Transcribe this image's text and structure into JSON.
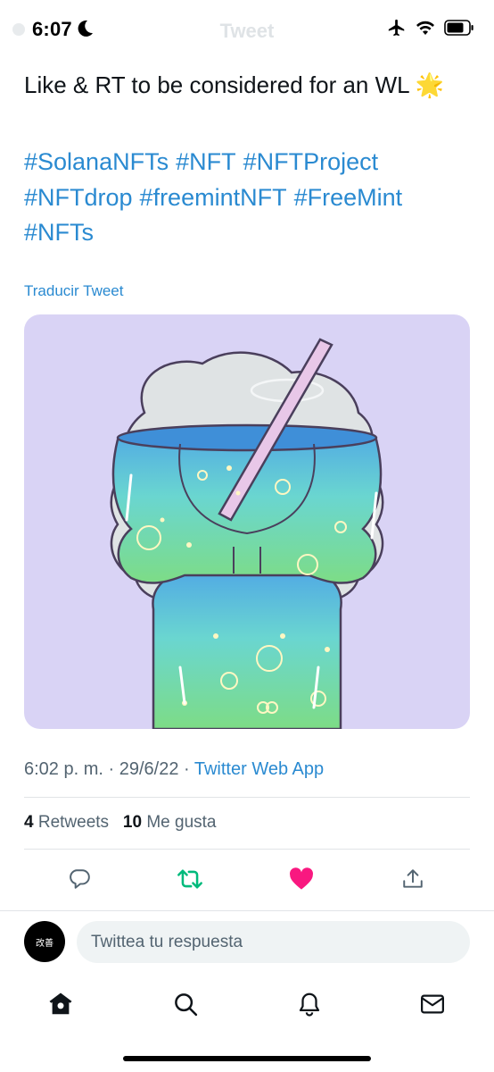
{
  "status_bar": {
    "time": "6:07"
  },
  "header": {
    "title": "Tweet"
  },
  "tweet": {
    "text": "Like & RT to be considered for an WL 🌟",
    "hashtags": [
      "#SolanaNFTs",
      "#NFT",
      "#NFTProject",
      "#NFTdrop",
      "#freemintNFT",
      "#FreeMint",
      "#NFTs"
    ],
    "translate_label": "Traducir Tweet",
    "timestamp": "6:02 p. m. · 29/6/22 · ",
    "source": "Twitter Web App"
  },
  "stats": {
    "retweets_count": "4",
    "retweets_label": "Retweets",
    "likes_count": "10",
    "likes_label": "Me gusta"
  },
  "reply": {
    "avatar_text": "改善",
    "placeholder": "Twittea tu respuesta"
  },
  "colors": {
    "link": "#2a8ad1",
    "retweet": "#00ba7c",
    "like": "#f91880",
    "media_background": "#d9d3f5"
  },
  "icons": {
    "reply": "speech-bubble-icon",
    "retweet": "retweet-icon",
    "like": "heart-icon",
    "share": "share-icon",
    "tabs": [
      "home-icon",
      "search-icon",
      "bell-icon",
      "mail-icon"
    ]
  }
}
